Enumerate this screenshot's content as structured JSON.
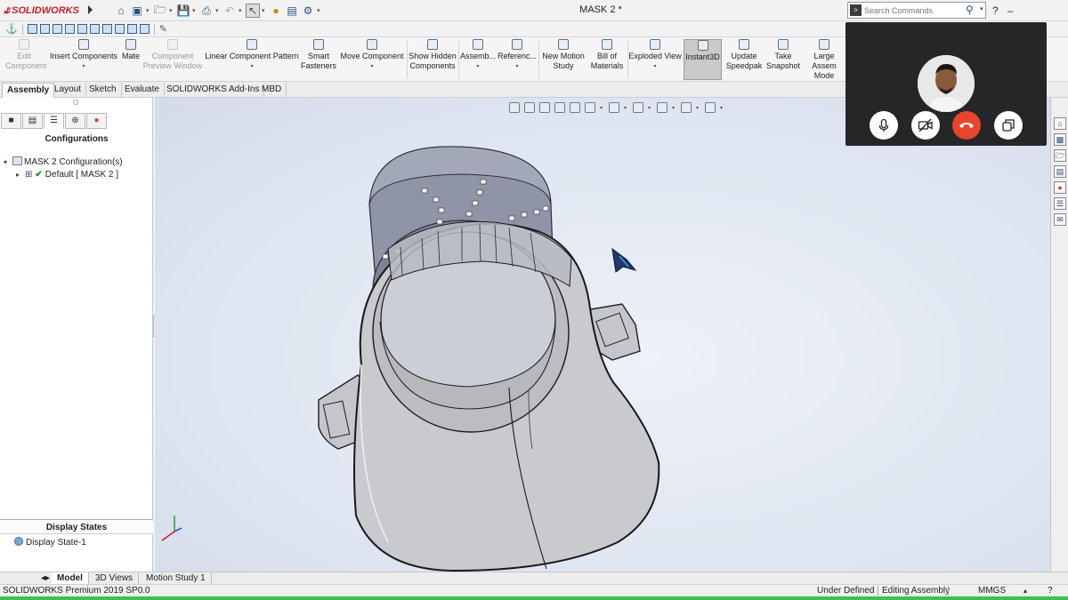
{
  "titlebar": {
    "app_name": "SOLIDWORKS",
    "document_title": "MASK 2 *",
    "search_placeholder": "Search Commands"
  },
  "command_manager": {
    "tools": [
      {
        "label": "Edit Component",
        "disabled": true
      },
      {
        "label": "Insert Components",
        "disabled": false
      },
      {
        "label": "Mate",
        "disabled": false
      },
      {
        "label": "Component Preview Window",
        "disabled": true
      },
      {
        "label": "Linear Component Pattern",
        "disabled": false
      },
      {
        "label": "Smart Fasteners",
        "disabled": false
      },
      {
        "label": "Move Component",
        "disabled": false
      },
      {
        "label": "Show Hidden Components",
        "disabled": false
      },
      {
        "label": "Assemb...",
        "disabled": false
      },
      {
        "label": "Referenc...",
        "disabled": false
      },
      {
        "label": "New Motion Study",
        "disabled": false
      },
      {
        "label": "Bill of Materials",
        "disabled": false
      },
      {
        "label": "Exploded View",
        "disabled": false
      },
      {
        "label": "Instant3D",
        "disabled": false,
        "selected": true
      },
      {
        "label": "Update Speedpak",
        "disabled": false
      },
      {
        "label": "Take Snapshot",
        "disabled": false
      },
      {
        "label": "Large Assem Mode",
        "disabled": false
      }
    ]
  },
  "tabs": [
    "Assembly",
    "Layout",
    "Sketch",
    "Evaluate",
    "SOLIDWORKS Add-Ins",
    "MBD"
  ],
  "active_tab": "Assembly",
  "left_panel": {
    "title": "Configurations",
    "tree": {
      "root_label": "MASK 2 Configuration(s)",
      "child_label": "Default [ MASK 2 ]"
    },
    "display_states_title": "Display States",
    "display_state_item": "Display State-1"
  },
  "bottom_tabs": [
    "Model",
    "3D Views",
    "Motion Study 1"
  ],
  "active_bottom_tab": "Model",
  "status": {
    "product": "SOLIDWORKS Premium 2019 SP0.0",
    "state": "Under Defined",
    "mode": "Editing Assembly",
    "units": "MMGS"
  },
  "colors": {
    "accent_red": "#c8202a",
    "end_call": "#e9452d",
    "status_green": "#3ec24a",
    "viewport_bg": "#dde4f0"
  }
}
